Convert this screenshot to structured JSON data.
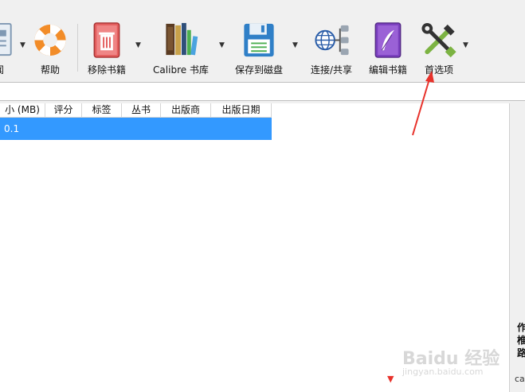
{
  "toolbar": {
    "items": [
      {
        "label": "闻",
        "icon": "news-icon"
      },
      {
        "label": "帮助",
        "icon": "help-lifebuoy-icon"
      },
      {
        "label": "移除书籍",
        "icon": "remove-books-icon"
      },
      {
        "label": "Calibre 书库",
        "icon": "library-books-icon"
      },
      {
        "label": "保存到磁盘",
        "icon": "save-disk-icon"
      },
      {
        "label": "连接/共享",
        "icon": "connect-share-icon"
      },
      {
        "label": "编辑书籍",
        "icon": "edit-book-icon"
      },
      {
        "label": "首选项",
        "icon": "preferences-tools-icon"
      }
    ]
  },
  "table": {
    "columns": [
      "小 (MB)",
      "评分",
      "标签",
      "丛书",
      "出版商",
      "出版日期"
    ],
    "rows": [
      {
        "size": "0.1"
      }
    ]
  },
  "details_panel": {
    "lines": [
      "作",
      "椎",
      "路"
    ],
    "code": "ca"
  },
  "watermark": {
    "text": "Baidu 经验",
    "sub": "jingyan.baidu.com"
  },
  "colors": {
    "selection": "#3399ff",
    "annotation_red": "#e8322b"
  }
}
